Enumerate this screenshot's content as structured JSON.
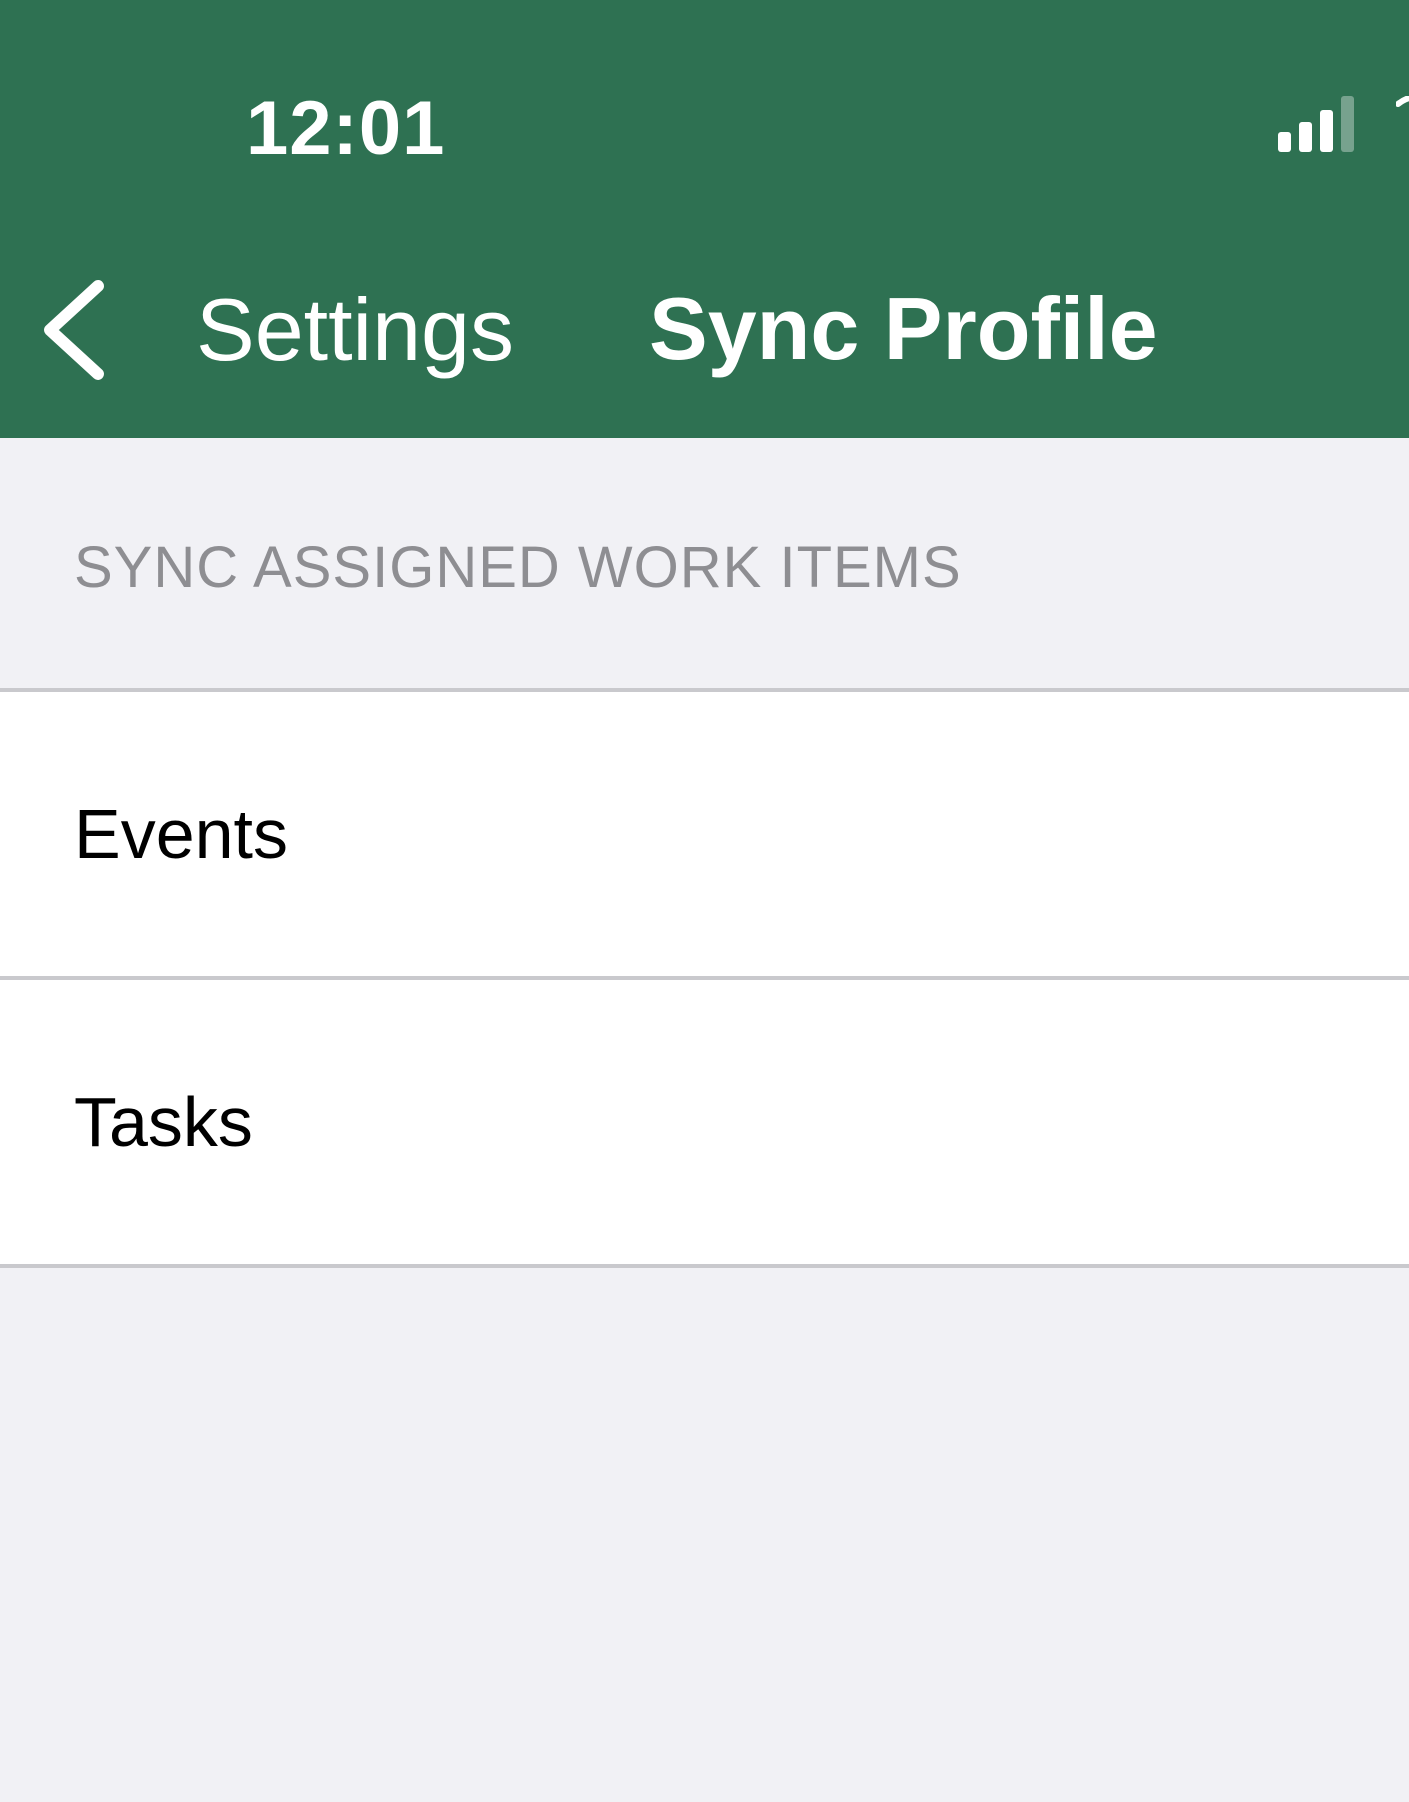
{
  "status_bar": {
    "time": "12:01",
    "signal_icon": "cellular-signal-icon",
    "wifi_icon": "wifi-icon"
  },
  "nav_bar": {
    "back_label": "Settings",
    "back_icon": "chevron-left-icon",
    "title": "Sync Profile"
  },
  "section": {
    "header": "SYNC ASSIGNED WORK ITEMS",
    "items": [
      {
        "label": "Events"
      },
      {
        "label": "Tasks"
      }
    ]
  },
  "colors": {
    "header_bg": "#2e7152",
    "page_bg": "#f1f1f5",
    "section_header_text": "#8e8e92",
    "separator": "#c9c9cd"
  }
}
